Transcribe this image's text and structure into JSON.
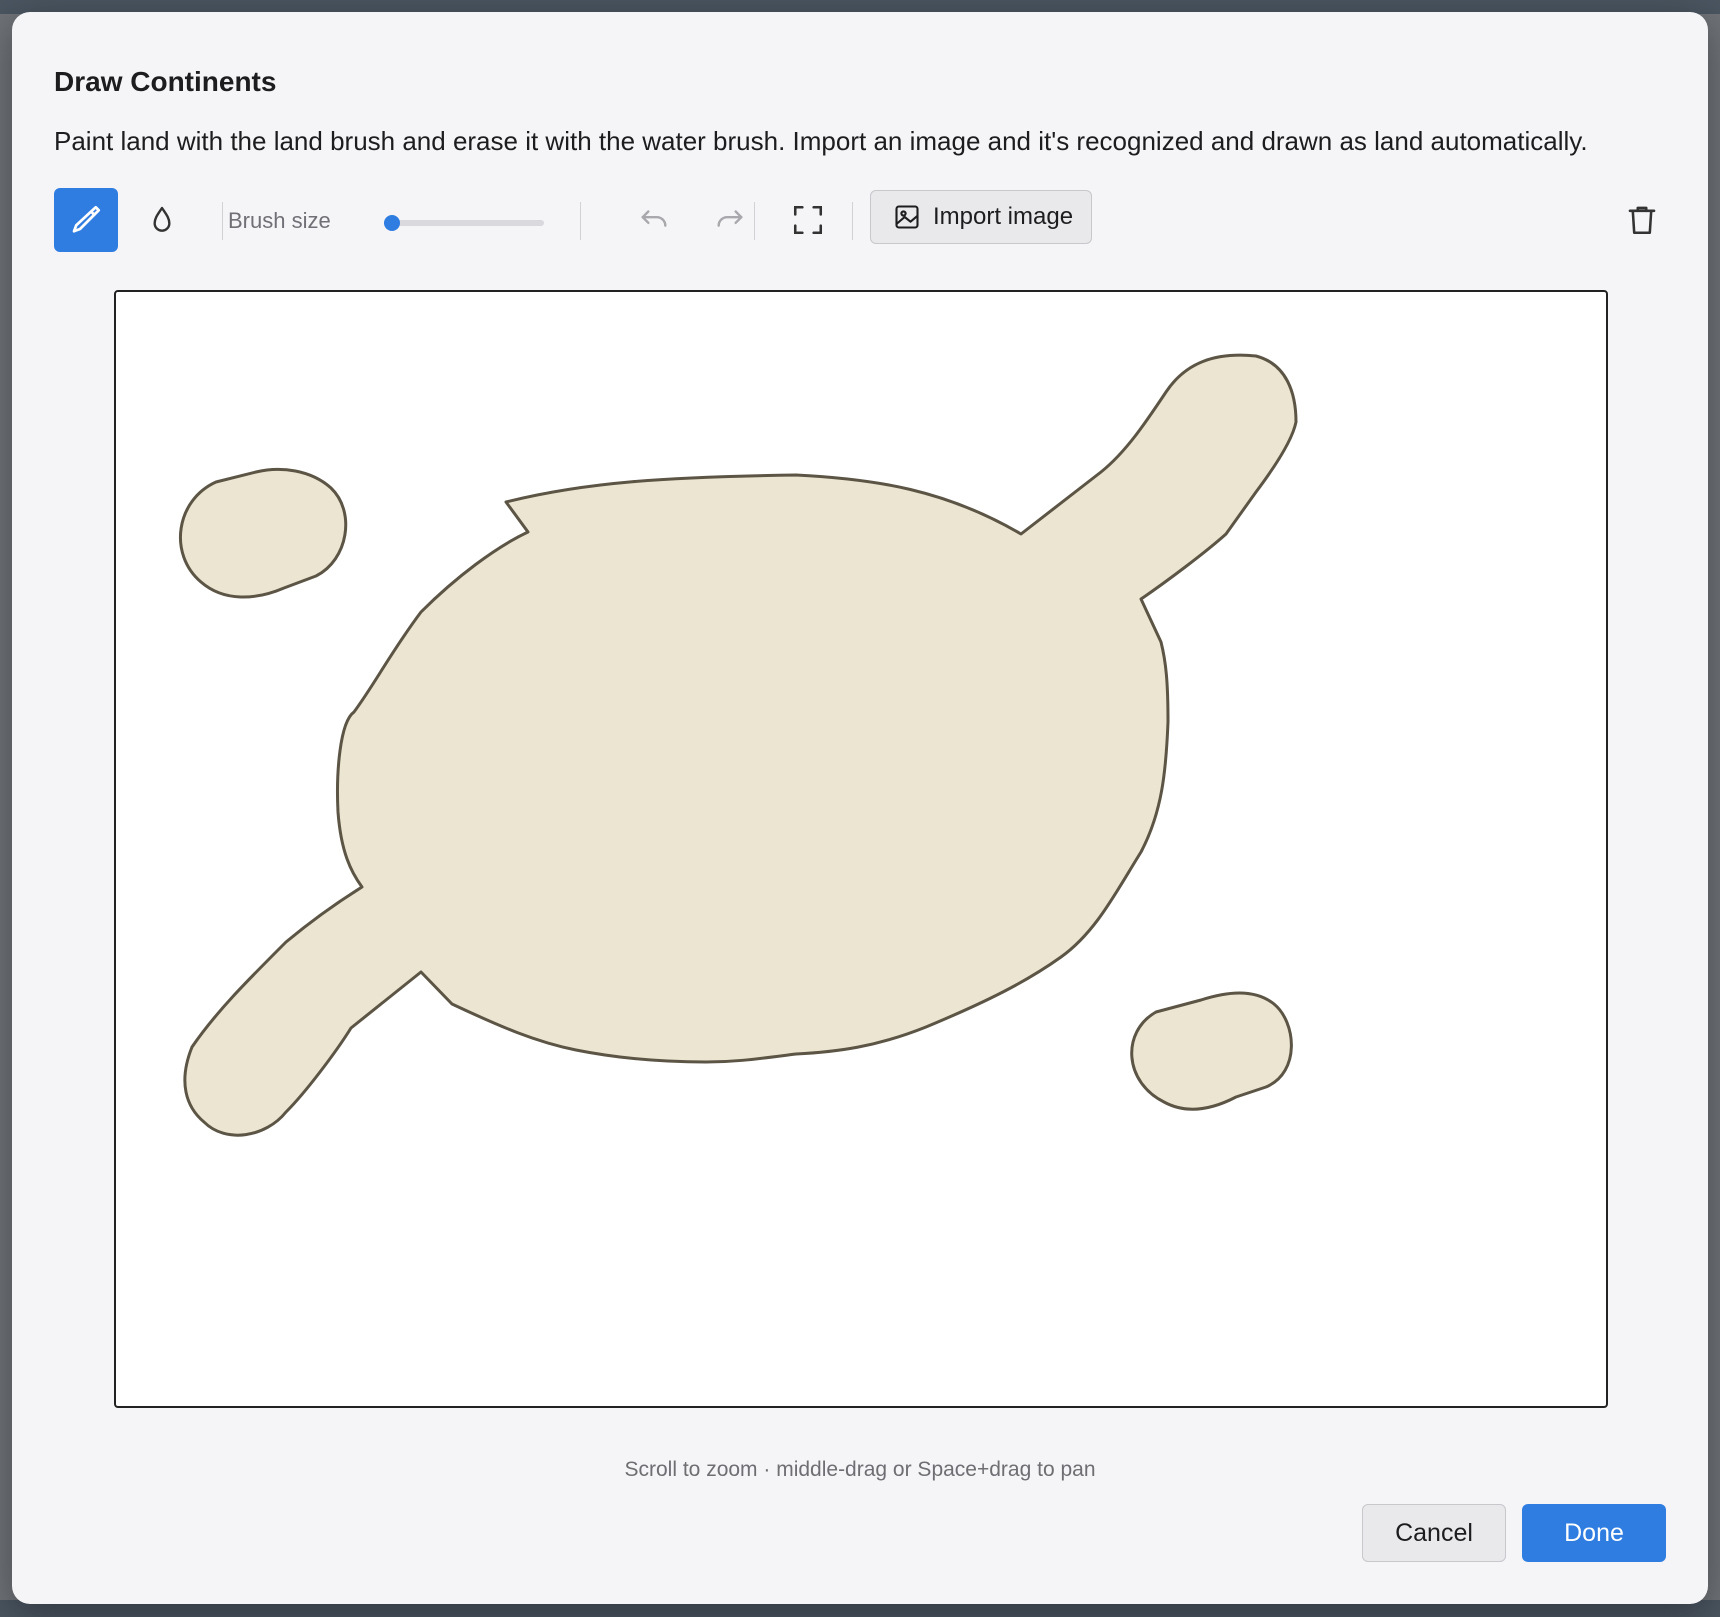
{
  "dialog": {
    "title": "Draw Continents",
    "description": "Paint land with the land brush and erase it with the water brush. Import an image and it's recognized and drawn as land automatically."
  },
  "toolbar": {
    "land_brush_icon": "brush-icon",
    "water_brush_icon": "water-drop-icon",
    "brush_size_label": "Brush size",
    "brush_size_fraction": 0.05,
    "undo_icon": "undo-icon",
    "redo_icon": "redo-icon",
    "fit_icon": "fit-to-screen-icon",
    "import_label": "Import image",
    "import_icon": "image-icon",
    "clear_icon": "trash-icon",
    "accent_color": "#2f7de1"
  },
  "canvas": {
    "land_color": "#ebe5d2",
    "coast_color": "#5c5545",
    "water_color": "#ffffff"
  },
  "hint": "Scroll to zoom · middle-drag or Space+drag to pan",
  "footer": {
    "cancel_label": "Cancel",
    "done_label": "Done"
  }
}
